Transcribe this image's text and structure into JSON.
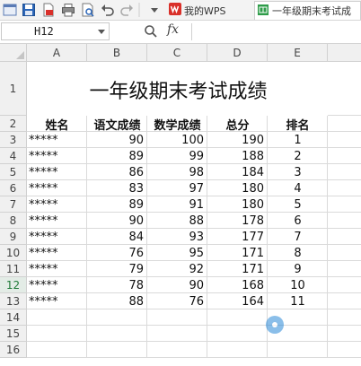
{
  "toolbar": {
    "tabs": [
      {
        "label": "我的WPS"
      },
      {
        "label": "一年级期末考试成"
      }
    ]
  },
  "formula_bar": {
    "name_box": "H12",
    "fx_label": "fx",
    "formula_value": ""
  },
  "sheet": {
    "columns": [
      "A",
      "B",
      "C",
      "D",
      "E"
    ],
    "rows": [
      "1",
      "2",
      "3",
      "4",
      "5",
      "6",
      "7",
      "8",
      "9",
      "10",
      "11",
      "12",
      "13",
      "14",
      "15",
      "16"
    ],
    "active_row": "12",
    "title": "一年级期末考试成绩",
    "headers": [
      "姓名",
      "语文成绩",
      "数学成绩",
      "总分",
      "排名"
    ],
    "data": [
      [
        "*****",
        "90",
        "100",
        "190",
        "1"
      ],
      [
        "*****",
        "89",
        "99",
        "188",
        "2"
      ],
      [
        "*****",
        "86",
        "98",
        "184",
        "3"
      ],
      [
        "*****",
        "83",
        "97",
        "180",
        "4"
      ],
      [
        "*****",
        "89",
        "91",
        "180",
        "5"
      ],
      [
        "*****",
        "90",
        "88",
        "178",
        "6"
      ],
      [
        "*****",
        "84",
        "93",
        "177",
        "7"
      ],
      [
        "*****",
        "76",
        "95",
        "171",
        "8"
      ],
      [
        "*****",
        "79",
        "92",
        "171",
        "9"
      ],
      [
        "*****",
        "78",
        "90",
        "168",
        "10"
      ],
      [
        "*****",
        "88",
        "76",
        "164",
        "11"
      ]
    ]
  },
  "colors": {
    "wps_red": "#d9302a",
    "active_row_text": "#1e7a37",
    "header_bg": "#f0f0f0"
  }
}
